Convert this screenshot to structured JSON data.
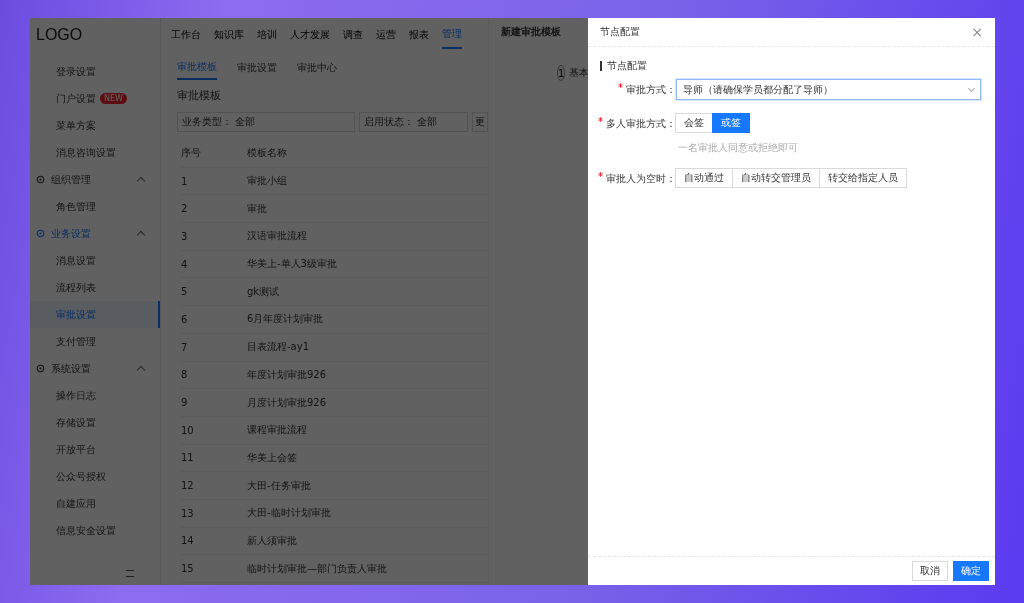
{
  "logo": "LOGO",
  "top_nav": [
    {
      "label": "工作台",
      "selected": false
    },
    {
      "label": "知识库",
      "selected": false
    },
    {
      "label": "培训",
      "selected": false
    },
    {
      "label": "人才发展",
      "selected": false
    },
    {
      "label": "调查",
      "selected": false
    },
    {
      "label": "运营",
      "selected": false
    },
    {
      "label": "报表",
      "selected": false
    },
    {
      "label": "管理",
      "selected": true
    }
  ],
  "sidebar": {
    "items": [
      {
        "kind": "item",
        "label": "登录设置",
        "selected": false
      },
      {
        "kind": "item",
        "label": "门户设置",
        "selected": false,
        "badge": "NEW"
      },
      {
        "kind": "item",
        "label": "菜单方案",
        "selected": false
      },
      {
        "kind": "item",
        "label": "消息咨询设置",
        "selected": false
      },
      {
        "kind": "group",
        "label": "组织管理",
        "expanded": true,
        "active": false,
        "children": [
          {
            "kind": "item",
            "label": "角色管理",
            "selected": false
          }
        ]
      },
      {
        "kind": "group",
        "label": "业务设置",
        "expanded": true,
        "active": true,
        "children": [
          {
            "kind": "item",
            "label": "消息设置",
            "selected": false
          },
          {
            "kind": "item",
            "label": "流程列表",
            "selected": false
          },
          {
            "kind": "item",
            "label": "审批设置",
            "selected": true
          },
          {
            "kind": "item",
            "label": "支付管理",
            "selected": false
          }
        ]
      },
      {
        "kind": "group",
        "label": "系统设置",
        "expanded": true,
        "active": false,
        "children": [
          {
            "kind": "item",
            "label": "操作日志",
            "selected": false
          },
          {
            "kind": "item",
            "label": "存储设置",
            "selected": false
          },
          {
            "kind": "item",
            "label": "开放平台",
            "selected": false
          },
          {
            "kind": "item",
            "label": "公众号授权",
            "selected": false
          },
          {
            "kind": "item",
            "label": "自建应用",
            "selected": false
          },
          {
            "kind": "item",
            "label": "信息安全设置",
            "selected": false
          }
        ]
      }
    ]
  },
  "sub_tabs": [
    {
      "label": "审批模板",
      "selected": true
    },
    {
      "label": "审批设置",
      "selected": false
    },
    {
      "label": "审批中心",
      "selected": false
    }
  ],
  "heading": "审批模板",
  "filters": [
    {
      "label": "业务类型：",
      "value": "全部"
    },
    {
      "label": "启用状态：",
      "value": "全部"
    },
    {
      "label": "更"
    }
  ],
  "table": {
    "columns": [
      "序号",
      "模板名称"
    ],
    "rows": [
      [
        "1",
        "审批小组"
      ],
      [
        "2",
        "审批"
      ],
      [
        "3",
        "汉语审批流程"
      ],
      [
        "4",
        "华美上-单人3级审批"
      ],
      [
        "5",
        "gk测试"
      ],
      [
        "6",
        "6月年度计划审批"
      ],
      [
        "7",
        "目表流程-ay1"
      ],
      [
        "8",
        "年度计划审批926"
      ],
      [
        "9",
        "月度计划审批926"
      ],
      [
        "10",
        "课程审批流程"
      ],
      [
        "11",
        "华美上会签"
      ],
      [
        "12",
        "大田-任务审批"
      ],
      [
        "13",
        "大田-临时计划审批"
      ],
      [
        "14",
        "新人须审批"
      ],
      [
        "15",
        "临时计划审批—部门负责人审批"
      ]
    ]
  },
  "template_panel": {
    "title": "新建审批模板",
    "step": {
      "number": "1",
      "label": "基本"
    }
  },
  "drawer": {
    "title": "节点配置",
    "close": "×",
    "section": "节点配置",
    "fields": [
      {
        "kind": "select",
        "label": "审批方式：",
        "required": true,
        "value": "导师（请确保学员都分配了导师）"
      },
      {
        "kind": "segmented",
        "label": "多人审批方式：",
        "required": true,
        "options": [
          {
            "label": "会签",
            "selected": false
          },
          {
            "label": "或签",
            "selected": true
          }
        ],
        "hint": "一名审批人同意或拒绝即可"
      },
      {
        "kind": "segmented",
        "label": "审批人为空时：",
        "required": true,
        "options": [
          {
            "label": "自动通过",
            "selected": false
          },
          {
            "label": "自动转交管理员",
            "selected": false
          },
          {
            "label": "转交给指定人员",
            "selected": false
          }
        ]
      }
    ],
    "buttons": [
      {
        "label": "取消",
        "primary": false
      },
      {
        "label": "确定",
        "primary": true
      }
    ]
  }
}
